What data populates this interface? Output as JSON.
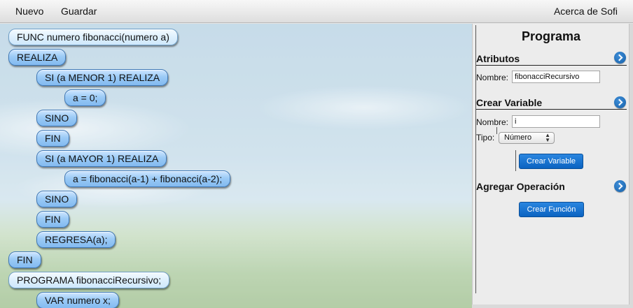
{
  "menubar": {
    "nuevo": "Nuevo",
    "guardar": "Guardar",
    "acerca": "Acerca de Sofi"
  },
  "code_blocks": [
    "FUNC numero fibonacci(numero a)",
    "REALIZA",
    "SI (a MENOR 1) REALIZA",
    "a = 0;",
    "SINO",
    "FIN",
    "SI (a MAYOR 1) REALIZA",
    "a = fibonacci(a-1) + fibonacci(a-2);",
    "SINO",
    "FIN",
    "REGRESA(a);",
    "FIN",
    "PROGRAMA fibonacciRecursivo;",
    "VAR numero x;"
  ],
  "panel": {
    "title": "Programa",
    "atributos": {
      "title": "Atributos",
      "nombre_label": "Nombre:",
      "nombre_value": "fibonacciRecursivo"
    },
    "crear_variable": {
      "title": "Crear Variable",
      "nombre_label": "Nombre:",
      "nombre_value": "i",
      "tipo_label": "Tipo:",
      "tipo_value": "Número",
      "button": "Crear Variable"
    },
    "agregar_operacion": {
      "title": "Agregar Operación",
      "button": "Crear Función"
    }
  },
  "icons": {
    "section_toggle": "chevron-right-circle-icon",
    "select_arrows": "up-down-arrows-icon"
  },
  "colors": {
    "block_blue": "#9ccbf6",
    "block_border": "#3f79b7",
    "button_blue": "#0b63c1",
    "chevron_blue": "#145fa8"
  }
}
